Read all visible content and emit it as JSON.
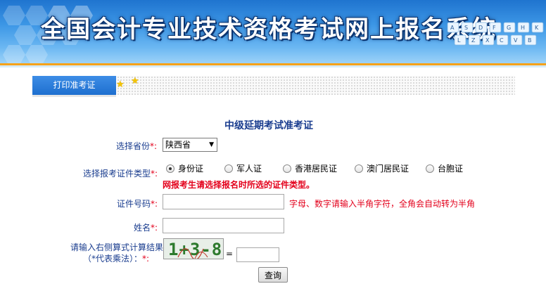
{
  "banner": {
    "title": "全国会计专业技术资格考试网上报名系统",
    "key_letters": [
      "A",
      "S",
      "D",
      "F",
      "G",
      "H",
      "K",
      "L",
      "Z",
      "X",
      "C",
      "V",
      "B"
    ]
  },
  "tabs": [
    {
      "label": "打印准考证",
      "active": true
    }
  ],
  "form": {
    "title": "中级延期考试准考证",
    "province": {
      "label": "选择省份",
      "required_mark": "*:",
      "value": "陕西省"
    },
    "id_type": {
      "label": "选择报考证件类型",
      "required_mark": "*:",
      "options": [
        "身份证",
        "军人证",
        "香港居民证",
        "澳门居民证",
        "台胞证"
      ],
      "selected": "身份证",
      "warning": "网报考生请选择报名时所选的证件类型。"
    },
    "id_number": {
      "label": "证件号码",
      "required_mark": "*:",
      "value": "",
      "hint": "字母、数字请输入半角字符，全角会自动转为半角"
    },
    "name": {
      "label": "姓名",
      "required_mark": "*:",
      "value": ""
    },
    "captcha": {
      "label_line1": "请输入右侧算式计算结果",
      "label_line2": "（*代表乘法）：",
      "required_mark": "*:",
      "image_text": "1+3-8",
      "equals": "=",
      "value": ""
    },
    "submit_label": "查询"
  },
  "colors": {
    "label_blue": "#1a3d8f",
    "required_red": "#e3001b",
    "tab_blue": "#1e6fcf",
    "accent_orange": "#f6a21a"
  }
}
